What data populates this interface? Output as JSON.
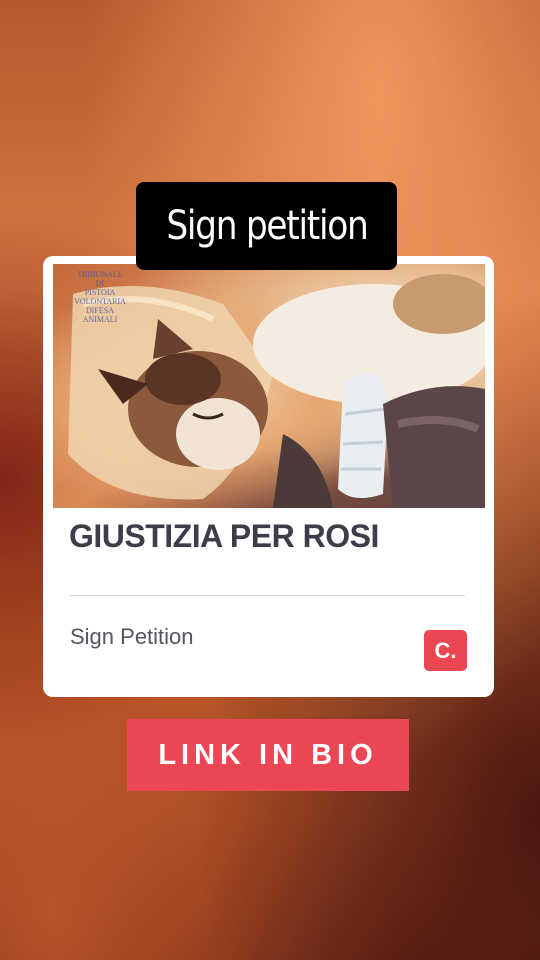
{
  "story": {
    "header_text": "Sign petition"
  },
  "petition_card": {
    "image_watermark": [
      "TRIBUNALE",
      "DI",
      "PISTOIA",
      "VOLONTARIA",
      "DIFESA",
      "ANIMALI"
    ],
    "title": "GIUSTIZIA PER ROSI",
    "action_label": "Sign Petition",
    "logo_text": "C."
  },
  "cta": {
    "label": "LINK IN BIO"
  },
  "colors": {
    "accent": "#ea4653",
    "header_bg": "#000000",
    "card_bg": "#ffffff",
    "title_text": "#3c3c4a"
  },
  "icons": {
    "logo": "change-org-logo-icon"
  }
}
